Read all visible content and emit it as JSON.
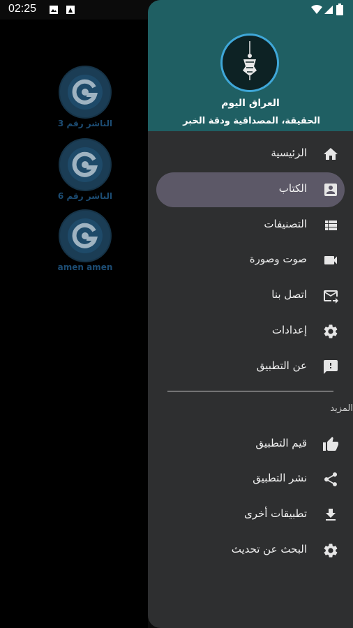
{
  "status_bar": {
    "time": "02:25"
  },
  "background_list": {
    "items": [
      {
        "label": "الناشر رقم 3"
      },
      {
        "label": "الناشر رقم 6"
      },
      {
        "label": "amen amen"
      }
    ]
  },
  "drawer": {
    "app_title": "العراق اليوم",
    "tagline": "الحقيقة، المصداقية ودقة الخبر",
    "menu": [
      {
        "label": "الرئيسية",
        "icon": "home-icon"
      },
      {
        "label": "الكتاب",
        "icon": "account-box-icon",
        "selected": true
      },
      {
        "label": "التصنيفات",
        "icon": "list-icon"
      },
      {
        "label": "صوت وصورة",
        "icon": "videocam-icon"
      },
      {
        "label": "اتصل بنا",
        "icon": "mail-send-icon"
      },
      {
        "label": "إعدادات",
        "icon": "settings-icon"
      },
      {
        "label": "عن التطبيق",
        "icon": "feedback-icon"
      }
    ],
    "more_section": {
      "title": "المزيد",
      "items": [
        {
          "label": "قيم التطبيق",
          "icon": "thumb-up-icon"
        },
        {
          "label": "نشر التطبيق",
          "icon": "share-icon"
        },
        {
          "label": "تطبيقات أخرى",
          "icon": "download-icon"
        },
        {
          "label": "البحث عن تحديث",
          "icon": "settings-icon"
        }
      ]
    }
  },
  "colors": {
    "header_bg": "#1f5f63",
    "drawer_bg": "#2e2f30",
    "selected_bg": "#5c5867",
    "logo_ring": "#3fa7d8"
  }
}
